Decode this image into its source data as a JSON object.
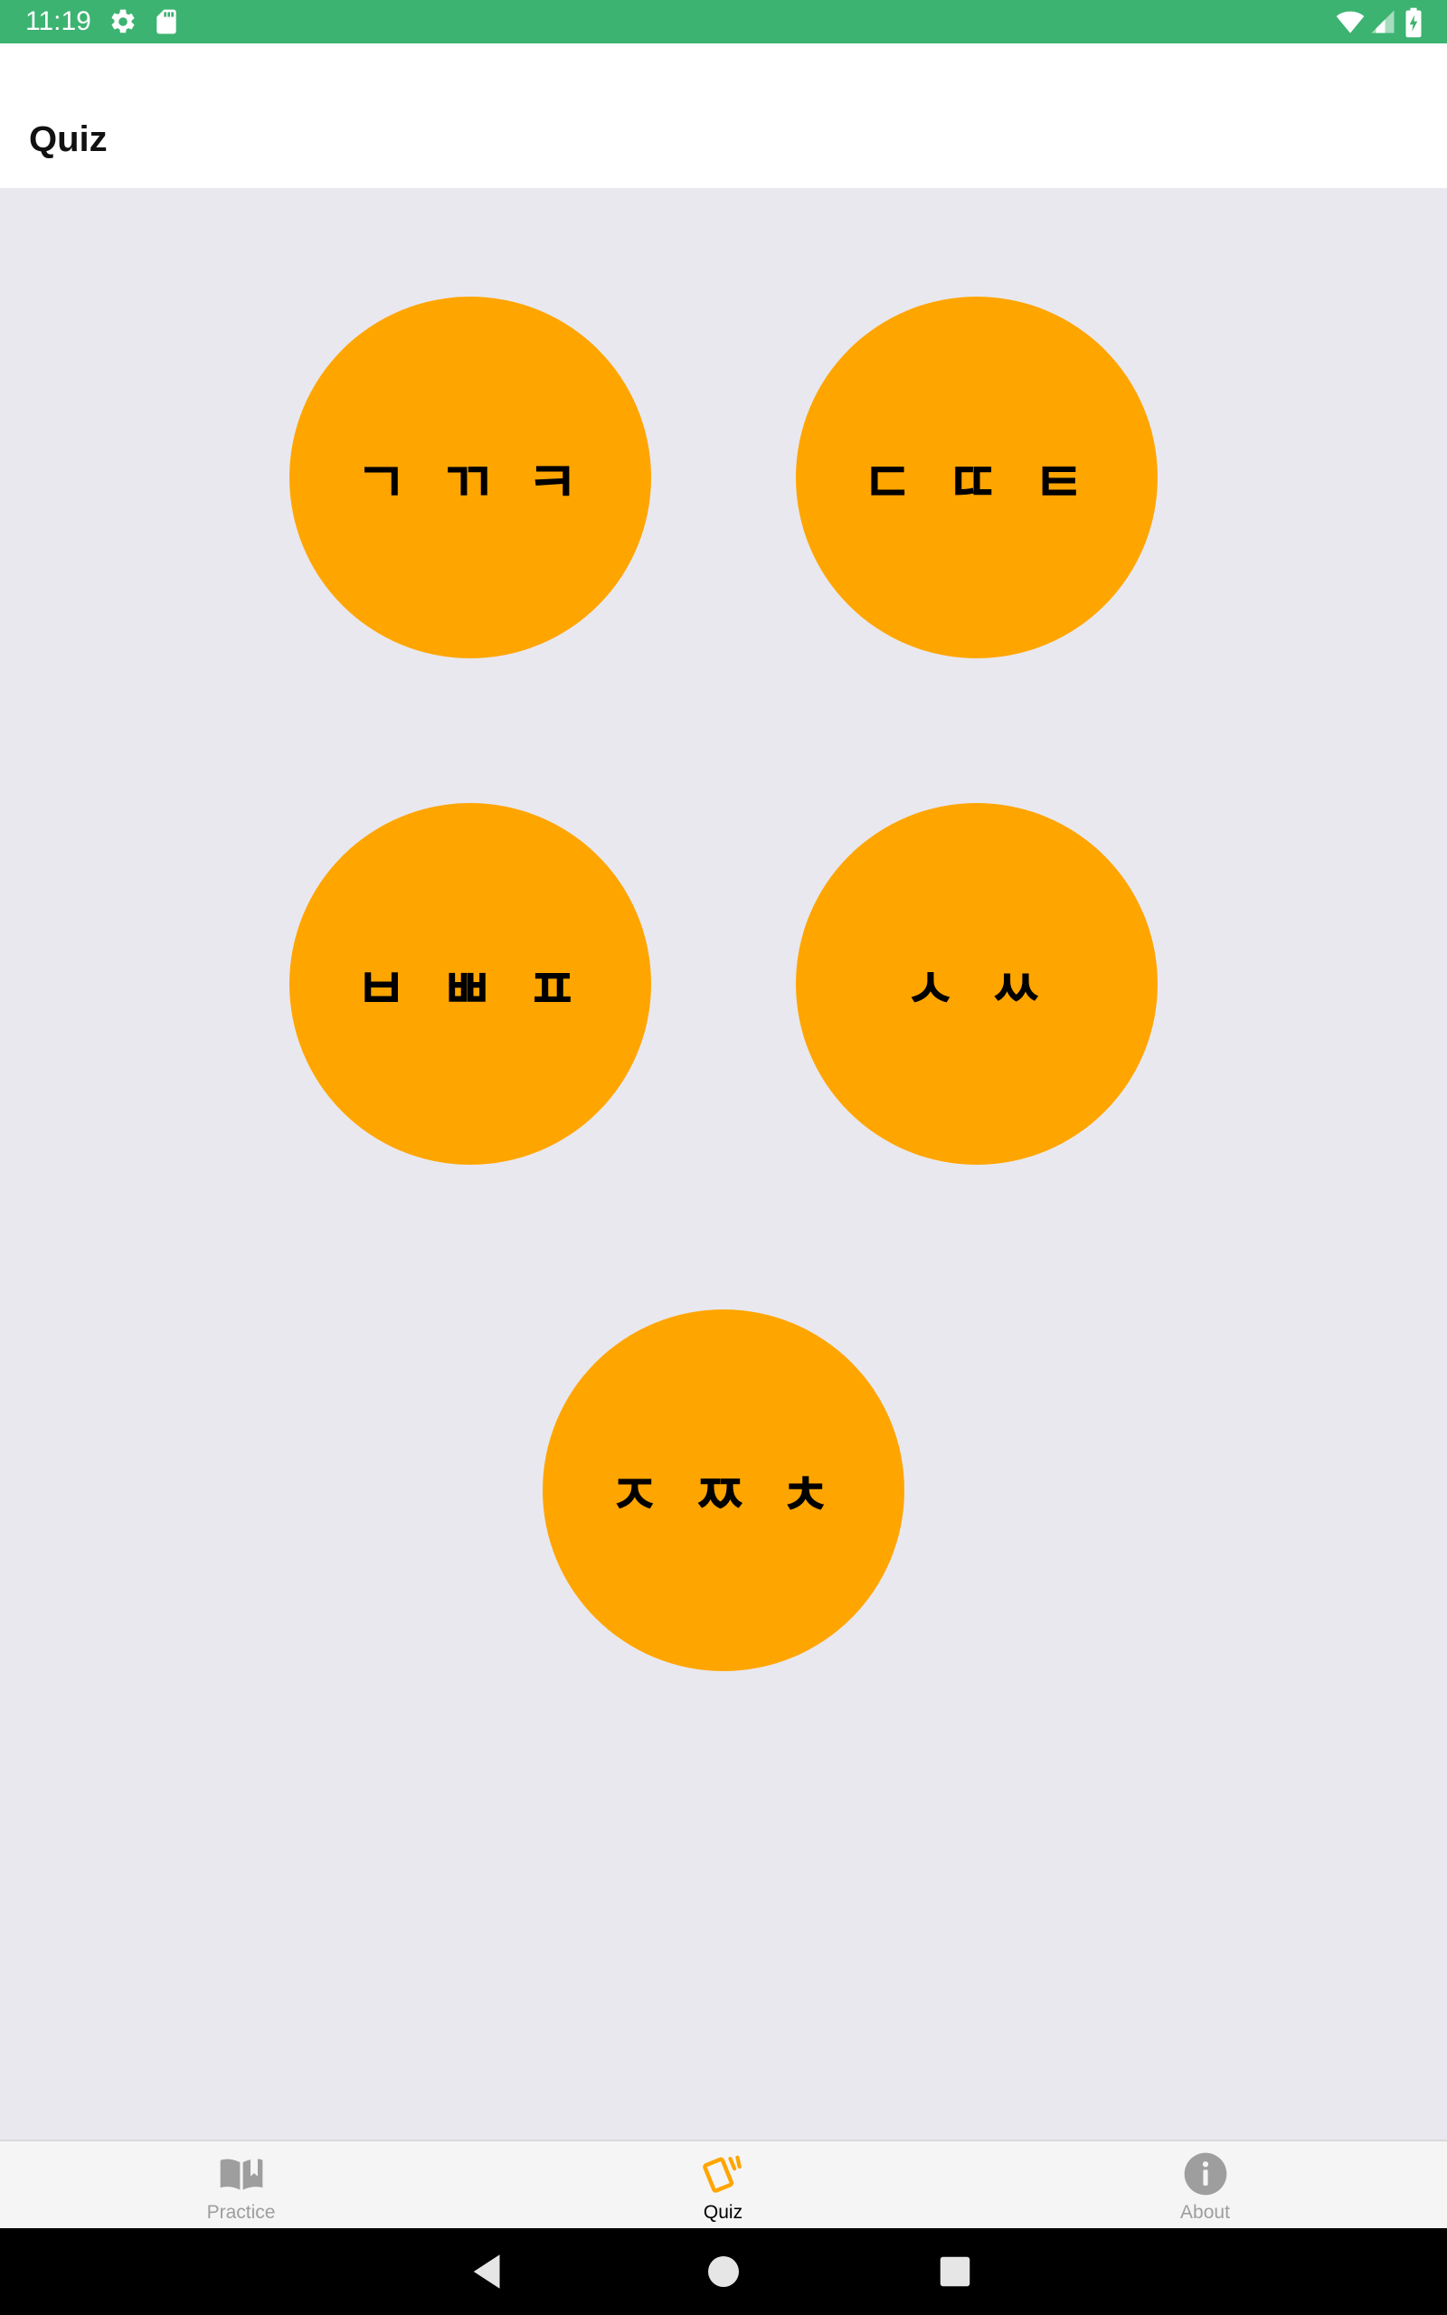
{
  "status_bar": {
    "time": "11:19",
    "background": "#3cb371",
    "left_icons": [
      "settings-icon",
      "sd-card-icon"
    ],
    "right_icons": [
      "wifi-icon",
      "cellular-signal-icon",
      "battery-charging-icon"
    ]
  },
  "app_bar": {
    "title": "Quiz"
  },
  "quiz_groups": [
    {
      "label": "ㄱ ㄲ ㅋ"
    },
    {
      "label": "ㄷ ㄸ ㅌ"
    },
    {
      "label": "ㅂ ㅃ ㅍ"
    },
    {
      "label": "ㅅ ㅆ"
    },
    {
      "label": "ㅈ ㅉ ㅊ"
    }
  ],
  "colors": {
    "accent": "#ffa500",
    "background": "#e9e8ee",
    "tab_active": "#000000",
    "tab_inactive": "#9e9e9e"
  },
  "tab_bar": {
    "active_tab": "Quiz",
    "tabs": [
      {
        "label": "Practice",
        "icon": "book-icon",
        "active": false
      },
      {
        "label": "Quiz",
        "icon": "flashcards-icon",
        "active": true
      },
      {
        "label": "About",
        "icon": "info-icon",
        "active": false
      }
    ]
  },
  "nav_bar": {
    "buttons": [
      "back-icon",
      "home-icon",
      "recents-icon"
    ]
  }
}
